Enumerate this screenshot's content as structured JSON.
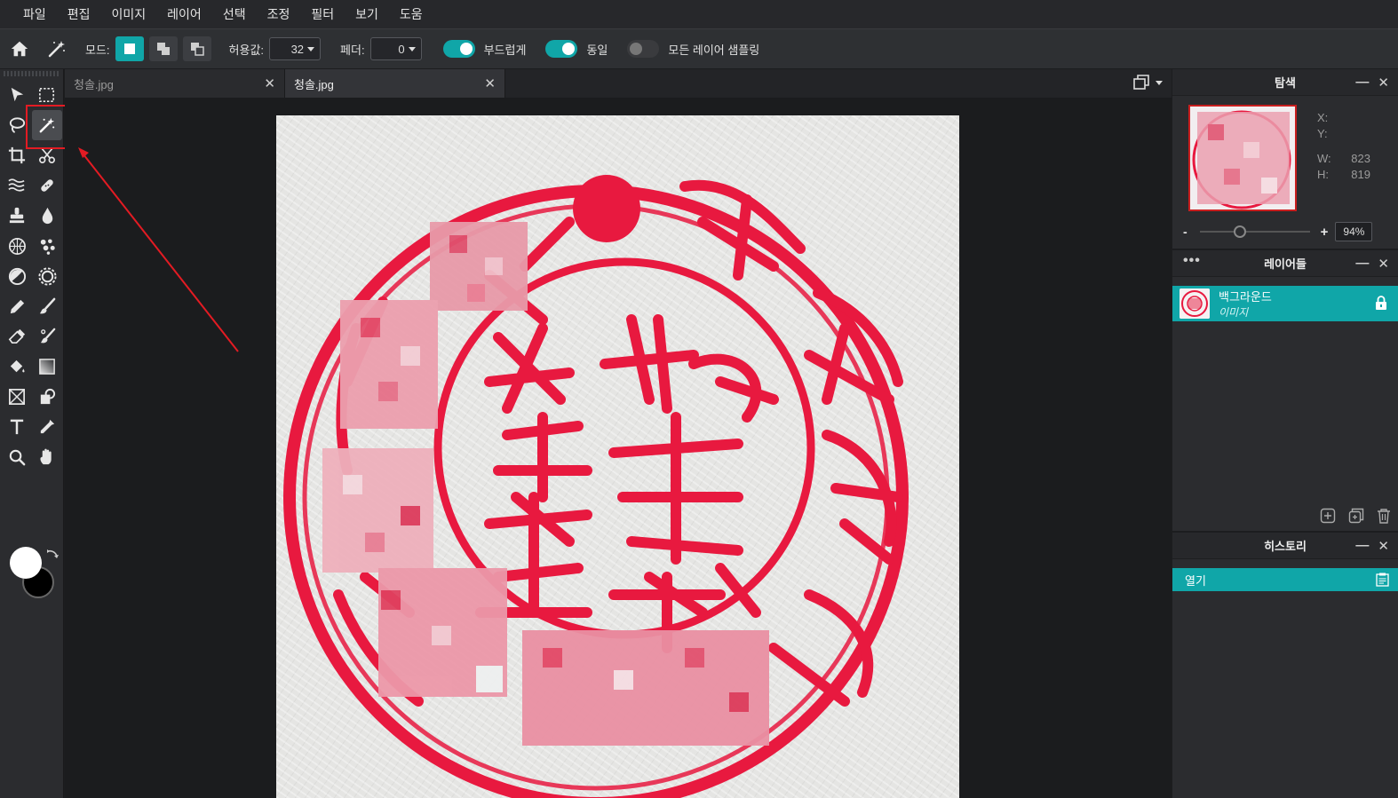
{
  "menu": [
    "파일",
    "편집",
    "이미지",
    "레이어",
    "선택",
    "조정",
    "필터",
    "보기",
    "도움"
  ],
  "options": {
    "mode_label": "모드:",
    "tolerance_label": "허용값:",
    "tolerance_value": "32",
    "feather_label": "페더:",
    "feather_value": "0",
    "smooth_label": "부드럽게",
    "smooth_on": true,
    "contiguous_label": "동일",
    "contiguous_on": true,
    "sample_all_label": "모든 레이어 샘플링",
    "sample_all_on": false
  },
  "tools": [
    [
      "move-tool-icon",
      "marquee-tool-icon"
    ],
    [
      "lasso-tool-icon",
      "magic-wand-tool-icon"
    ],
    [
      "crop-tool-icon",
      "cut-tool-icon"
    ],
    [
      "liquify-tool-icon",
      "heal-tool-icon"
    ],
    [
      "clone-stamp-tool-icon",
      "blur-tool-icon"
    ],
    [
      "sponge-tool-icon",
      "spot-tool-icon"
    ],
    [
      "dodge-tool-icon",
      "pinch-tool-icon"
    ],
    [
      "pencil-tool-icon",
      "brush-tool-icon"
    ],
    [
      "eraser-tool-icon",
      "color-replace-tool-icon"
    ],
    [
      "fill-bucket-tool-icon",
      "gradient-tool-icon"
    ],
    [
      "frame-tool-icon",
      "shape-tool-icon"
    ],
    [
      "text-tool-icon",
      "eyedropper-tool-icon"
    ],
    [
      "zoom-tool-icon",
      "hand-tool-icon"
    ]
  ],
  "selected_tool": "magic-wand-tool-icon",
  "colors": {
    "foreground": "#ffffff",
    "background": "#000000",
    "accent": "#10a6a8",
    "annotation": "#e31b23"
  },
  "tabs": [
    {
      "label": "청솔.jpg",
      "active": false
    },
    {
      "label": "청솔.jpg",
      "active": true
    }
  ],
  "navigator": {
    "title": "탐색",
    "x_label": "X:",
    "x_value": "",
    "y_label": "Y:",
    "y_value": "",
    "w_label": "W:",
    "w_value": "823",
    "h_label": "H:",
    "h_value": "819",
    "zoom_minus": "-",
    "zoom_plus": "+",
    "zoom_value": "94%"
  },
  "layers": {
    "title": "레이어들",
    "items": [
      {
        "name": "백그라운드",
        "type": "이미지",
        "locked": true
      }
    ]
  },
  "history": {
    "title": "히스토리",
    "items": [
      {
        "label": "열기"
      }
    ]
  }
}
